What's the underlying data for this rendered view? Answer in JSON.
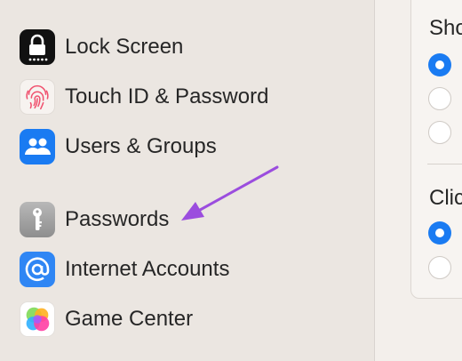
{
  "sidebar": {
    "items": [
      {
        "label": "Lock Screen",
        "icon": "lock-icon"
      },
      {
        "label": "Touch ID & Password",
        "icon": "fingerprint-icon"
      },
      {
        "label": "Users & Groups",
        "icon": "users-icon"
      },
      {
        "label": "Passwords",
        "icon": "key-icon"
      },
      {
        "label": "Internet Accounts",
        "icon": "at-sign-icon"
      },
      {
        "label": "Game Center",
        "icon": "game-center-icon"
      }
    ]
  },
  "main": {
    "section1": {
      "heading": "Sho",
      "selected_index": 0
    },
    "section2": {
      "heading": "Clic",
      "selected_index": 0
    }
  },
  "annotation": {
    "arrow_color": "#9b4dde"
  },
  "colors": {
    "accent": "#1a7bf2"
  }
}
